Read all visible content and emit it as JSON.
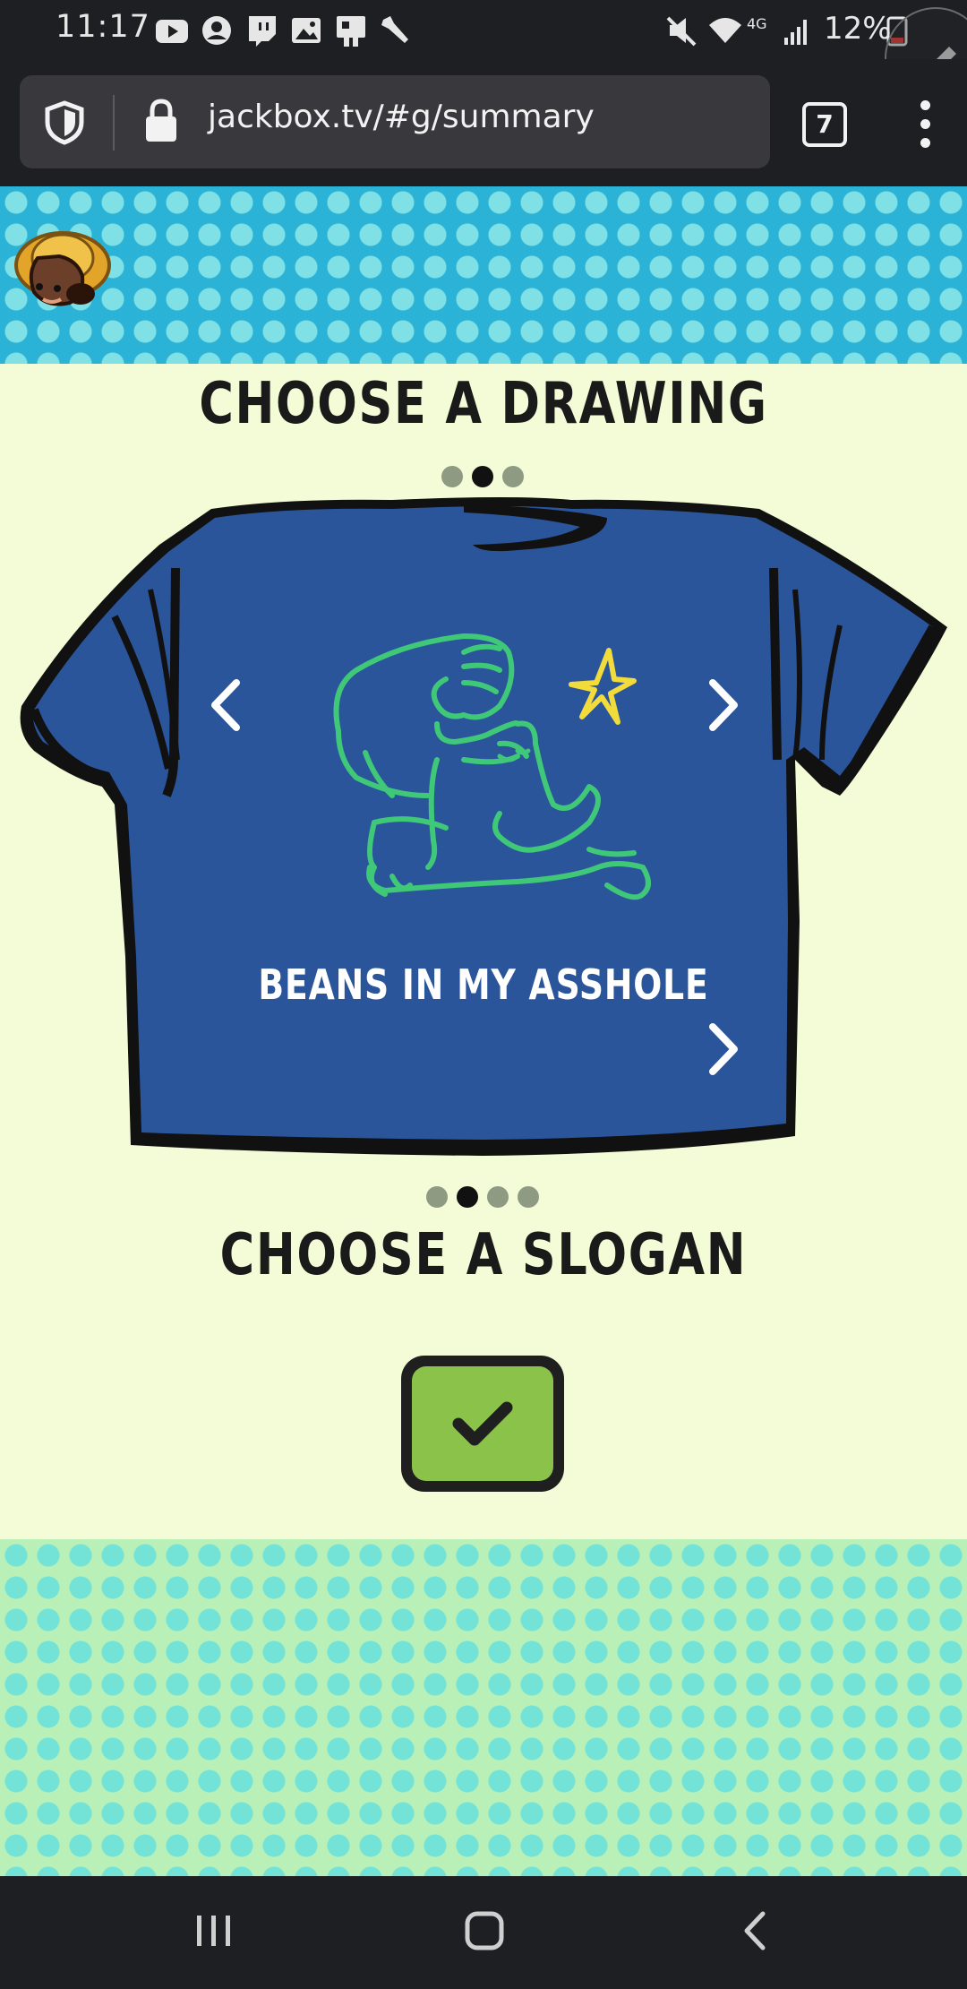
{
  "status_bar": {
    "time": "11:17",
    "battery_percent": "12%",
    "icons": [
      "youtube-icon",
      "account-circle-icon",
      "twitch-icon",
      "image-icon",
      "cast-icon",
      "wrench-icon",
      "mute-icon",
      "wifi-icon",
      "4g-icon",
      "signal-icon",
      "battery-icon"
    ]
  },
  "browser": {
    "url": "jackbox.tv/#g/summary",
    "tab_count": "7"
  },
  "game": {
    "drawing_heading": "CHOOSE A DRAWING",
    "drawing_dots": {
      "count": 3,
      "active": 1
    },
    "slogan": "BEANS IN MY ASSHOLE",
    "slogan_heading": "CHOOSE A SLOGAN",
    "slogan_dots": {
      "count": 4,
      "active": 1
    },
    "colors": {
      "shirt": "#2b559b",
      "drawing_green": "#3fc878",
      "drawing_yellow": "#f2dc3c",
      "submit_green": "#8bc34a",
      "background": "#f3fcd6",
      "header_pattern": "#2ab3d6"
    }
  }
}
